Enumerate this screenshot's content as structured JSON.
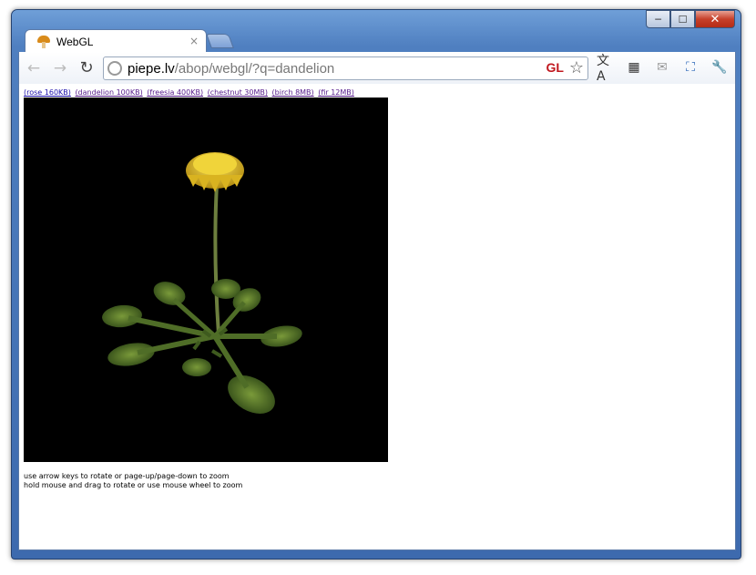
{
  "window": {
    "controls": {
      "minimize": "─",
      "maximize": "☐",
      "close": "✕"
    }
  },
  "tab": {
    "title": "WebGL",
    "close": "×"
  },
  "toolbar": {
    "back_icon": "←",
    "forward_icon": "→",
    "reload_icon": "↻",
    "url_host": "piepe.lv",
    "url_path": "/abop/webgl/?q=dandelion",
    "extension_label": "GL",
    "star_icon": "☆",
    "translate_icon": "文A",
    "qr_icon": "▦",
    "mail_icon": "✉",
    "fullscreen_icon": "⛶",
    "wrench_icon": "🔧"
  },
  "page": {
    "links": [
      {
        "label": "(rose 160KB)"
      },
      {
        "label": "(dandelion 100KB)"
      },
      {
        "label": "(freesia 400KB)"
      },
      {
        "label": "(chestnut 30MB)"
      },
      {
        "label": "(birch 8MB)"
      },
      {
        "label": "(fir 12MB)"
      }
    ],
    "instructions": [
      "use arrow keys to rotate or page-up/page-down to zoom",
      "hold mouse and drag to rotate or use mouse wheel to zoom"
    ]
  },
  "colors": {
    "flower": "#e6c21d",
    "leaf": "#4a6a25",
    "canvas": "#000000",
    "frame": "#4f7fc0"
  }
}
